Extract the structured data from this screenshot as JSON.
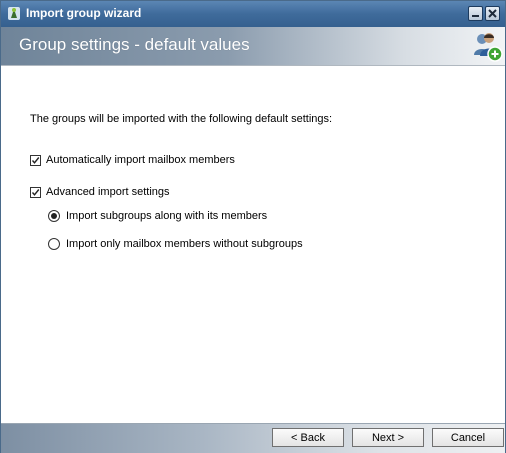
{
  "window": {
    "title": "Import group wizard"
  },
  "header": {
    "title": "Group settings - default values"
  },
  "content": {
    "intro": "The groups will be imported with the following default settings:",
    "auto_import": {
      "label": "Automatically import mailbox members",
      "checked": true
    },
    "advanced": {
      "label": "Advanced import settings",
      "checked": true
    },
    "radio_subgroups": {
      "label": "Import subgroups along with its members",
      "selected": true
    },
    "radio_members_only": {
      "label": "Import only mailbox members without subgroups",
      "selected": false
    }
  },
  "footer": {
    "back_label": "< Back",
    "next_label": "Next >",
    "cancel_label": "Cancel"
  },
  "colors": {
    "titlebar": "#3f6b9b",
    "header_dark": "#6f8499",
    "footer_dark": "#7d8fa3"
  },
  "icons": {
    "app": "app-icon",
    "header": "users-add-icon",
    "minimize": "minimize-icon",
    "close": "close-icon"
  }
}
